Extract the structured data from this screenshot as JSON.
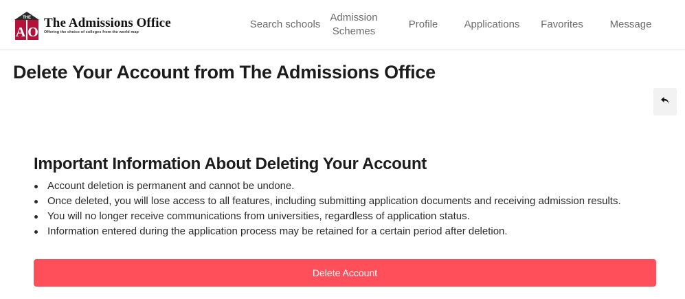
{
  "header": {
    "logo_icon": "college-building-logo-icon",
    "logo_small_text": "THE",
    "logo_letters": [
      "A",
      "O"
    ],
    "brand_title": "The Admissions Office",
    "brand_tagline": "Offering the choice of colleges from the world map",
    "brand_color": "#b5123a",
    "nav": [
      {
        "id": "search",
        "label": "Search schools"
      },
      {
        "id": "schemes",
        "label": "Admission Schemes"
      },
      {
        "id": "profile",
        "label": "Profile"
      },
      {
        "id": "applications",
        "label": "Applications"
      },
      {
        "id": "favorites",
        "label": "Favorites"
      },
      {
        "id": "message",
        "label": "Message"
      }
    ]
  },
  "main": {
    "page_title": "Delete Your Account from The Admissions Office",
    "back_icon": "reply-arrow-icon",
    "section_heading": "Important Information About Deleting Your Account",
    "notices": [
      "Account deletion is permanent and cannot be undone.",
      "Once deleted, you will lose access to all features, including submitting application documents and receiving admission results.",
      "You will no longer receive communications from universities, regardless of application status.",
      "Information entered during the application process may be retained for a certain period after deletion."
    ],
    "delete_button_label": "Delete Account",
    "delete_button_color": "#ff4f5a"
  }
}
